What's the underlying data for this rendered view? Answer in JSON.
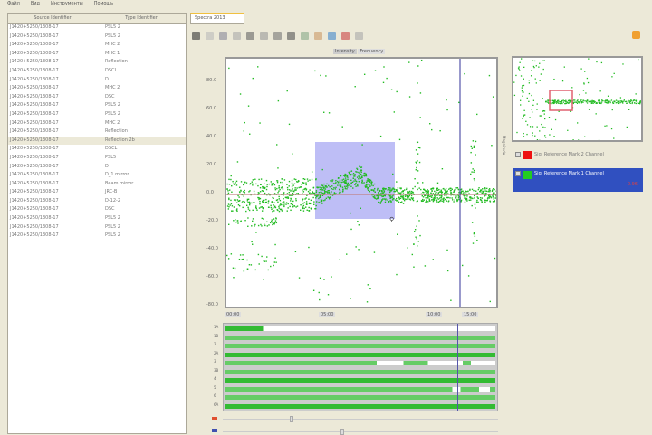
{
  "menu": [
    "Файл",
    "Вид",
    "Инструменты",
    "Помощь"
  ],
  "left_panel": {
    "headers": [
      "Source Identifier",
      "Type Identifier"
    ],
    "rows": [
      [
        "J1420+5250/1308-17",
        "PSL5 2"
      ],
      [
        "J1420+5250/1308-17",
        "PSL5 2"
      ],
      [
        "J1420+5250/1308-17",
        "MHC 2"
      ],
      [
        "J1420+5250/1308-17",
        "MHC 1"
      ],
      [
        "J1420+5250/1308-17",
        "Reflection"
      ],
      [
        "J1420+5250/1308-17",
        "DSCL"
      ],
      [
        "J1420+5250/1308-17",
        "D"
      ],
      [
        "J1420+5250/1308-17",
        "MHC 2"
      ],
      [
        "J1420+5250/1308-17",
        "DSC"
      ],
      [
        "J1420+5250/1308-17",
        "PSL5 2"
      ],
      [
        "J1420+5250/1308-17",
        "PSL5 2"
      ],
      [
        "J1420+5250/1308-17",
        "MHC 2"
      ],
      [
        "J1420+5250/1308-17",
        "Reflection"
      ],
      [
        "J1420+5250/1308-17",
        "Reflection 2b"
      ],
      [
        "J1420+5250/1308-17",
        "DSCL"
      ],
      [
        "J1420+5250/1308-17",
        "PSL5"
      ],
      [
        "J1420+5250/1308-17",
        "D"
      ],
      [
        "J1420+5250/1308-17",
        "D_1 mirror"
      ],
      [
        "J1420+5250/1308-17",
        "Beam mirror"
      ],
      [
        "J1420+5250/1308-17",
        "JRC-B"
      ],
      [
        "J1420+5250/1308-17",
        "D-12-2"
      ],
      [
        "J1420+5250/1308-17",
        "DSC"
      ],
      [
        "J1420+5250/1308-17",
        "PSL5 2"
      ],
      [
        "J1420+5250/1308-17",
        "PSL5 2"
      ],
      [
        "J1420+5250/1308-17",
        "PSL5 2"
      ]
    ],
    "selected_row": 13
  },
  "tab": "Spectra 2013",
  "toolbar": {
    "icons": [
      "pointer-icon",
      "select-icon",
      "zoom-box-icon",
      "zoom-in-icon",
      "pan-icon",
      "reset-icon",
      "fit-icon",
      "grid-icon",
      "line-icon",
      "brush-icon",
      "cursor-icon",
      "color-icon",
      "export-icon"
    ]
  },
  "plot": {
    "title": "Intensity",
    "title2": "Frequency",
    "y_ticks": [
      "80.0",
      "60.0",
      "40.0",
      "20.0",
      "0.0",
      "-20.0",
      "-40.0",
      "-60.0",
      "-80.0"
    ],
    "x_ticks": [
      "00:00",
      "05:00",
      "10:00",
      "15:00"
    ],
    "accent": "#22bb22",
    "selection": "#8888ee",
    "cursor": "#5555aa"
  },
  "strip": {
    "labels": [
      "1A",
      "1B",
      "2",
      "2A",
      "3",
      "3B",
      "4",
      "5",
      "6",
      "6A"
    ]
  },
  "legend": [
    {
      "label": "Sig. Reference Mark 2 Channel",
      "color": "#ee1111"
    },
    {
      "label": "Sig. Reference Mark 1 Channel",
      "color": "#22cc22",
      "value": "0.96",
      "selected": true
    }
  ],
  "side_label": "Magnitude"
}
